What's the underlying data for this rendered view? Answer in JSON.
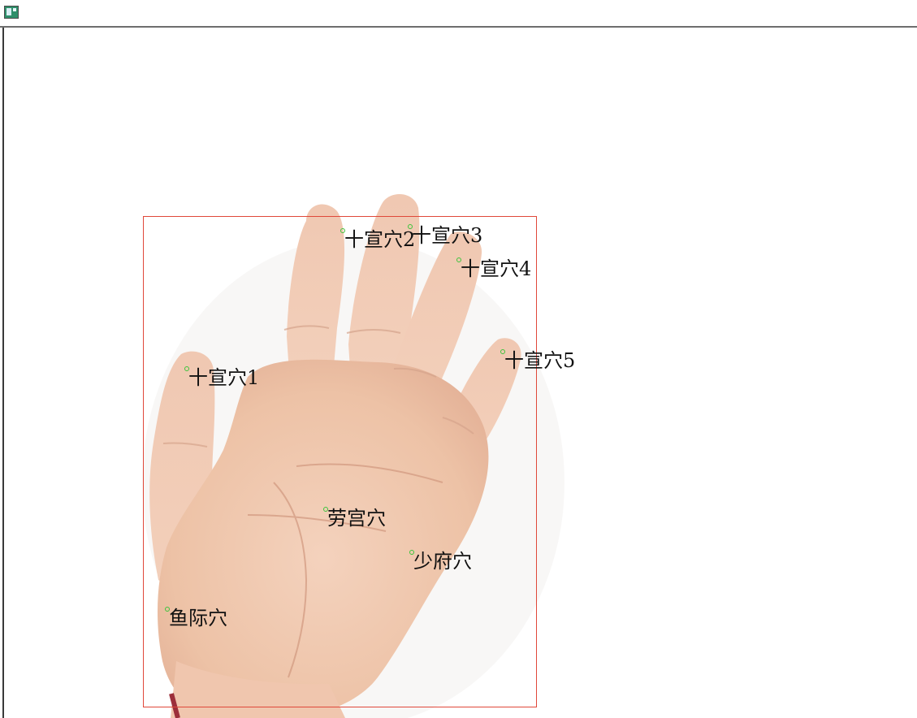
{
  "window": {
    "icon": "app-window-icon"
  },
  "colors": {
    "detection_box": "#e0483a",
    "acupoint_marker": "#3cc43c",
    "label_text": "#111111",
    "skin": "#f2c9b0"
  },
  "points": [
    {
      "id": "shixuan-1",
      "label": "十宣穴1"
    },
    {
      "id": "shixuan-2",
      "label": "十宣穴2"
    },
    {
      "id": "shixuan-3",
      "label": "十宣穴3"
    },
    {
      "id": "shixuan-4",
      "label": "十宣穴4"
    },
    {
      "id": "shixuan-5",
      "label": "十宣穴5"
    },
    {
      "id": "laogong",
      "label": "劳宫穴"
    },
    {
      "id": "shaofu",
      "label": "少府穴"
    },
    {
      "id": "yuji",
      "label": "鱼际穴"
    }
  ]
}
